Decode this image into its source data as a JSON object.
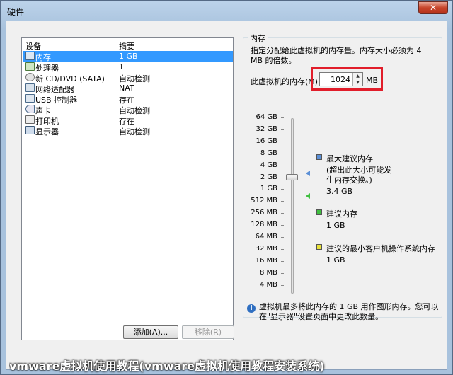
{
  "window": {
    "title": "硬件",
    "close_glyph": "✕"
  },
  "device_list": {
    "headers": {
      "device": "设备",
      "summary": "摘要"
    },
    "rows": [
      {
        "name": "内存",
        "summary": "1 GB",
        "selected": true
      },
      {
        "name": "处理器",
        "summary": "1",
        "selected": false
      },
      {
        "name": "新 CD/DVD (SATA)",
        "summary": "自动检测",
        "selected": false
      },
      {
        "name": "网络适配器",
        "summary": "NAT",
        "selected": false
      },
      {
        "name": "USB 控制器",
        "summary": "存在",
        "selected": false
      },
      {
        "name": "声卡",
        "summary": "自动检测",
        "selected": false
      },
      {
        "name": "打印机",
        "summary": "存在",
        "selected": false
      },
      {
        "name": "显示器",
        "summary": "自动检测",
        "selected": false
      }
    ],
    "add_button": "添加(A)...",
    "remove_button": "移除(R)"
  },
  "memory": {
    "group_title": "内存",
    "description": "指定分配给此虚拟机的内存量。内存大小必须为 4 MB 的倍数。",
    "field_label": "此虚拟机的内存(M):",
    "value": "1024",
    "unit": "MB",
    "scale": [
      "64 GB",
      "32 GB",
      "16 GB",
      "8 GB",
      "4 GB",
      "2 GB",
      "1 GB",
      "512 MB",
      "256 MB",
      "128 MB",
      "64 MB",
      "32 MB",
      "16 MB",
      "8 MB",
      "4 MB"
    ],
    "max_recommended": {
      "label": "最大建议内存",
      "note": "(超出此大小可能发生内存交换。)",
      "value": "3.4 GB",
      "color": "#5b8fd6"
    },
    "recommended": {
      "label": "建议内存",
      "value": "1 GB",
      "color": "#3fbf3f"
    },
    "min_guest": {
      "label": "建议的最小客户机操作系统内存",
      "value": "1 GB",
      "color": "#e8e23a"
    },
    "info": "虚拟机最多将此内存的 1 GB 用作图形内存。您可以在\"显示器\"设置页面中更改此数量。"
  },
  "watermark": "vmware虚拟机使用教程(vmware虚拟机使用教程安装系统)"
}
